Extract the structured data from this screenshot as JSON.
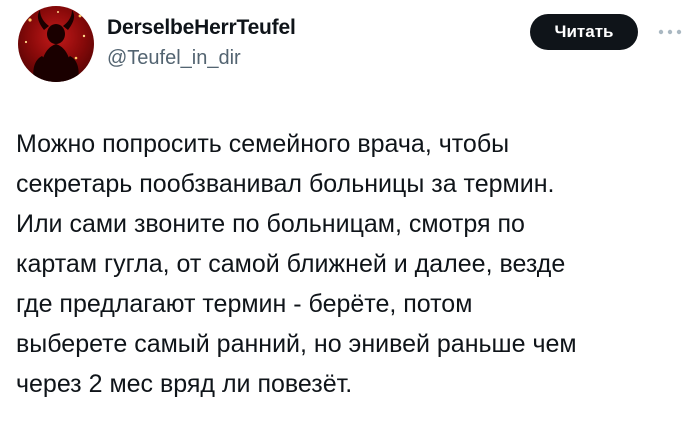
{
  "author": {
    "display_name": "DerselbeHerrTeufel",
    "handle": "@Teufel_in_dir",
    "avatar_icon": "devil-silhouette-icon"
  },
  "actions": {
    "follow_label": "Читать",
    "more_icon": "more-horizontal-icon"
  },
  "tweet": {
    "lines": [
      "Можно попросить семейного врача, чтобы",
      "секретарь пообзванивал больницы за термин.",
      "Или сами звоните по больницам, смотря по",
      "картам гугла, от самой ближней и далее, везде",
      "где предлагают термин - берёте, потом",
      "выберете самый ранний, но энивей раньше чем",
      "через 2 мес вряд ли повезёт."
    ]
  },
  "colors": {
    "text_primary": "#0f1419",
    "text_secondary": "#536471",
    "button_bg": "#0f1419",
    "button_text": "#ffffff",
    "avatar_red": "#c41a1a"
  }
}
